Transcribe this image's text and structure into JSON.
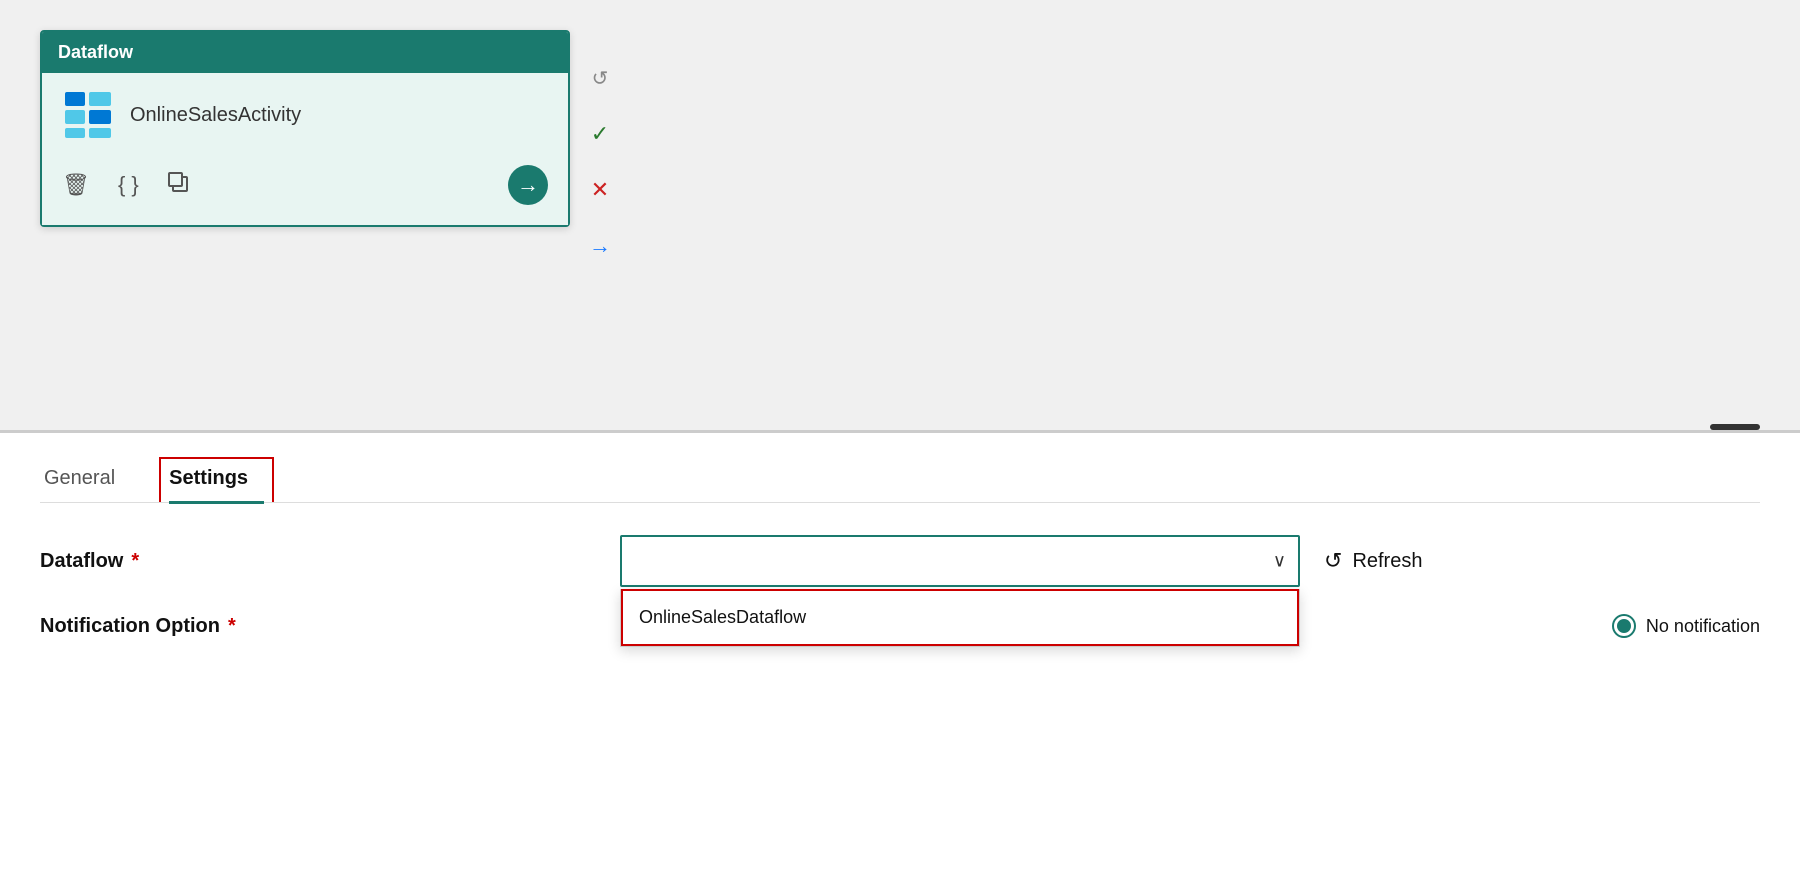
{
  "canvas": {
    "card": {
      "header": "Dataflow",
      "activity_name": "OnlineSalesActivity",
      "actions": {
        "delete_icon": "🗑",
        "code_icon": "{}",
        "copy_icon": "⧉",
        "arrow_icon": "→"
      }
    },
    "side_toolbar": {
      "redo_icon": "↺",
      "check_icon": "✓",
      "x_icon": "✕",
      "arrow_icon": "→"
    }
  },
  "bottom_panel": {
    "tabs": [
      {
        "label": "General",
        "active": false
      },
      {
        "label": "Settings",
        "active": true
      }
    ],
    "fields": {
      "dataflow": {
        "label": "Dataflow",
        "required": true,
        "placeholder": "",
        "dropdown_value": "",
        "dropdown_options": [
          {
            "label": "OnlineSalesDataflow"
          }
        ],
        "refresh_label": "Refresh"
      },
      "notification_option": {
        "label": "Notification Option",
        "required": true,
        "no_notification_label": "No notification"
      }
    }
  }
}
